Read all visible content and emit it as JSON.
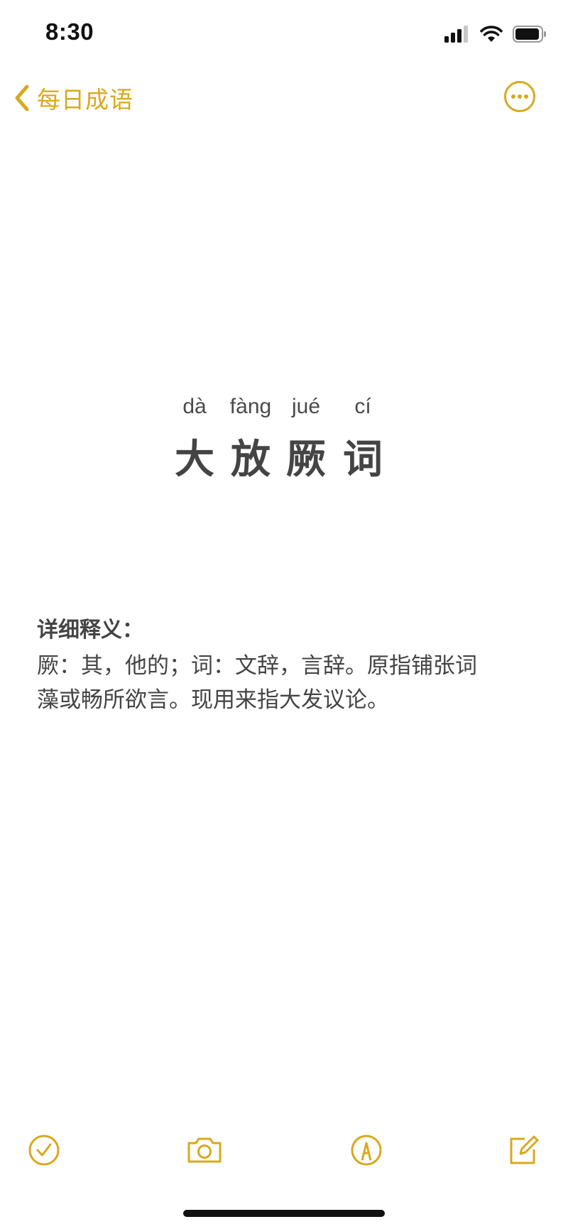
{
  "status_bar": {
    "time": "8:30"
  },
  "nav": {
    "back_label": "每日成语",
    "accent_color": "#d9a81f"
  },
  "idiom": {
    "pinyin": [
      "dà",
      "fàng",
      "jué",
      "cí"
    ],
    "hanzi": [
      "大",
      "放",
      "厥",
      "词"
    ]
  },
  "definition": {
    "heading": "详细释义：",
    "lines": [
      "厥：其，他的；词：文辞，言辞。原指铺张词",
      "藻或畅所欲言。现用来指大发议论。"
    ]
  },
  "toolbar": {
    "icons": [
      "checklist-icon",
      "camera-icon",
      "markup-icon",
      "compose-icon"
    ]
  }
}
